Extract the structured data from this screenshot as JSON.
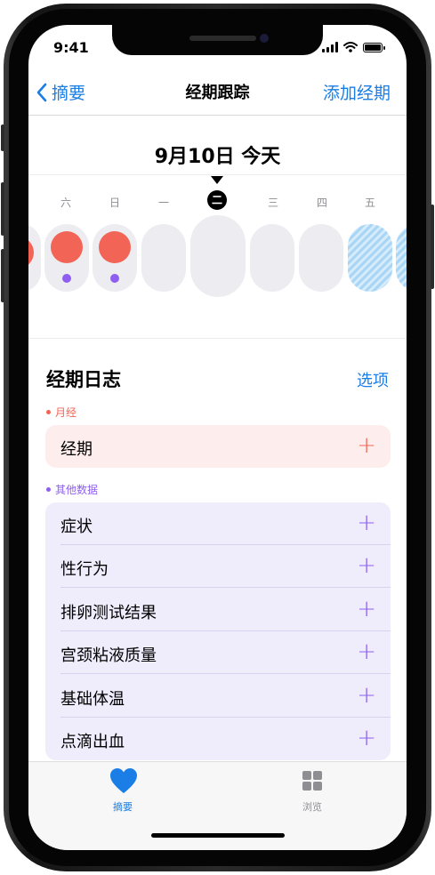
{
  "status_bar": {
    "time": "9:41"
  },
  "nav": {
    "back_label": "摘要",
    "title": "经期跟踪",
    "add_label": "添加经期"
  },
  "calendar": {
    "date_title": "9月10日 今天",
    "days": [
      "六",
      "日",
      "一",
      "二",
      "三",
      "四",
      "五"
    ],
    "today_index": 3
  },
  "log": {
    "title": "经期日志",
    "options_label": "选项",
    "period_category": {
      "label": "月经",
      "color": "#f26556"
    },
    "period_rows": [
      {
        "label": "经期"
      }
    ],
    "other_category": {
      "label": "其他数据",
      "color": "#8e5ef0"
    },
    "other_rows": [
      {
        "label": "症状"
      },
      {
        "label": "性行为"
      },
      {
        "label": "排卵测试结果"
      },
      {
        "label": "宫颈粘液质量"
      },
      {
        "label": "基础体温"
      },
      {
        "label": "点滴出血"
      }
    ],
    "plus_glyph": "+"
  },
  "tabbar": {
    "items": [
      {
        "label": "摘要",
        "icon": "heart-icon",
        "active": true
      },
      {
        "label": "浏览",
        "icon": "grid-icon",
        "active": false
      }
    ]
  },
  "colors": {
    "accent": "#1a7ee6",
    "period": "#f26556",
    "other": "#8e5ef0",
    "period_card": "#fdeeed",
    "other_card": "#efecfb"
  }
}
